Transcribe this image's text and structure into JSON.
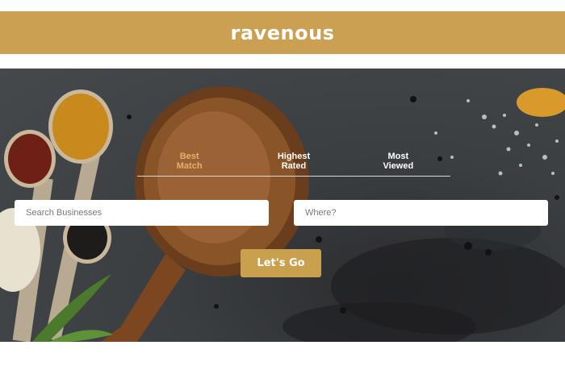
{
  "header": {
    "brand": "ravenous"
  },
  "search": {
    "sort_options": [
      {
        "line1": "Best",
        "line2": "Match",
        "active": true
      },
      {
        "line1": "Highest",
        "line2": "Rated",
        "active": false
      },
      {
        "line1": "Most",
        "line2": "Viewed",
        "active": false
      }
    ],
    "term_placeholder": "Search Businesses",
    "location_placeholder": "Where?",
    "submit_label": "Let's Go"
  },
  "colors": {
    "brand_gold": "#cba052",
    "active_tab": "#e2b26a",
    "button": "#c9a04e"
  }
}
